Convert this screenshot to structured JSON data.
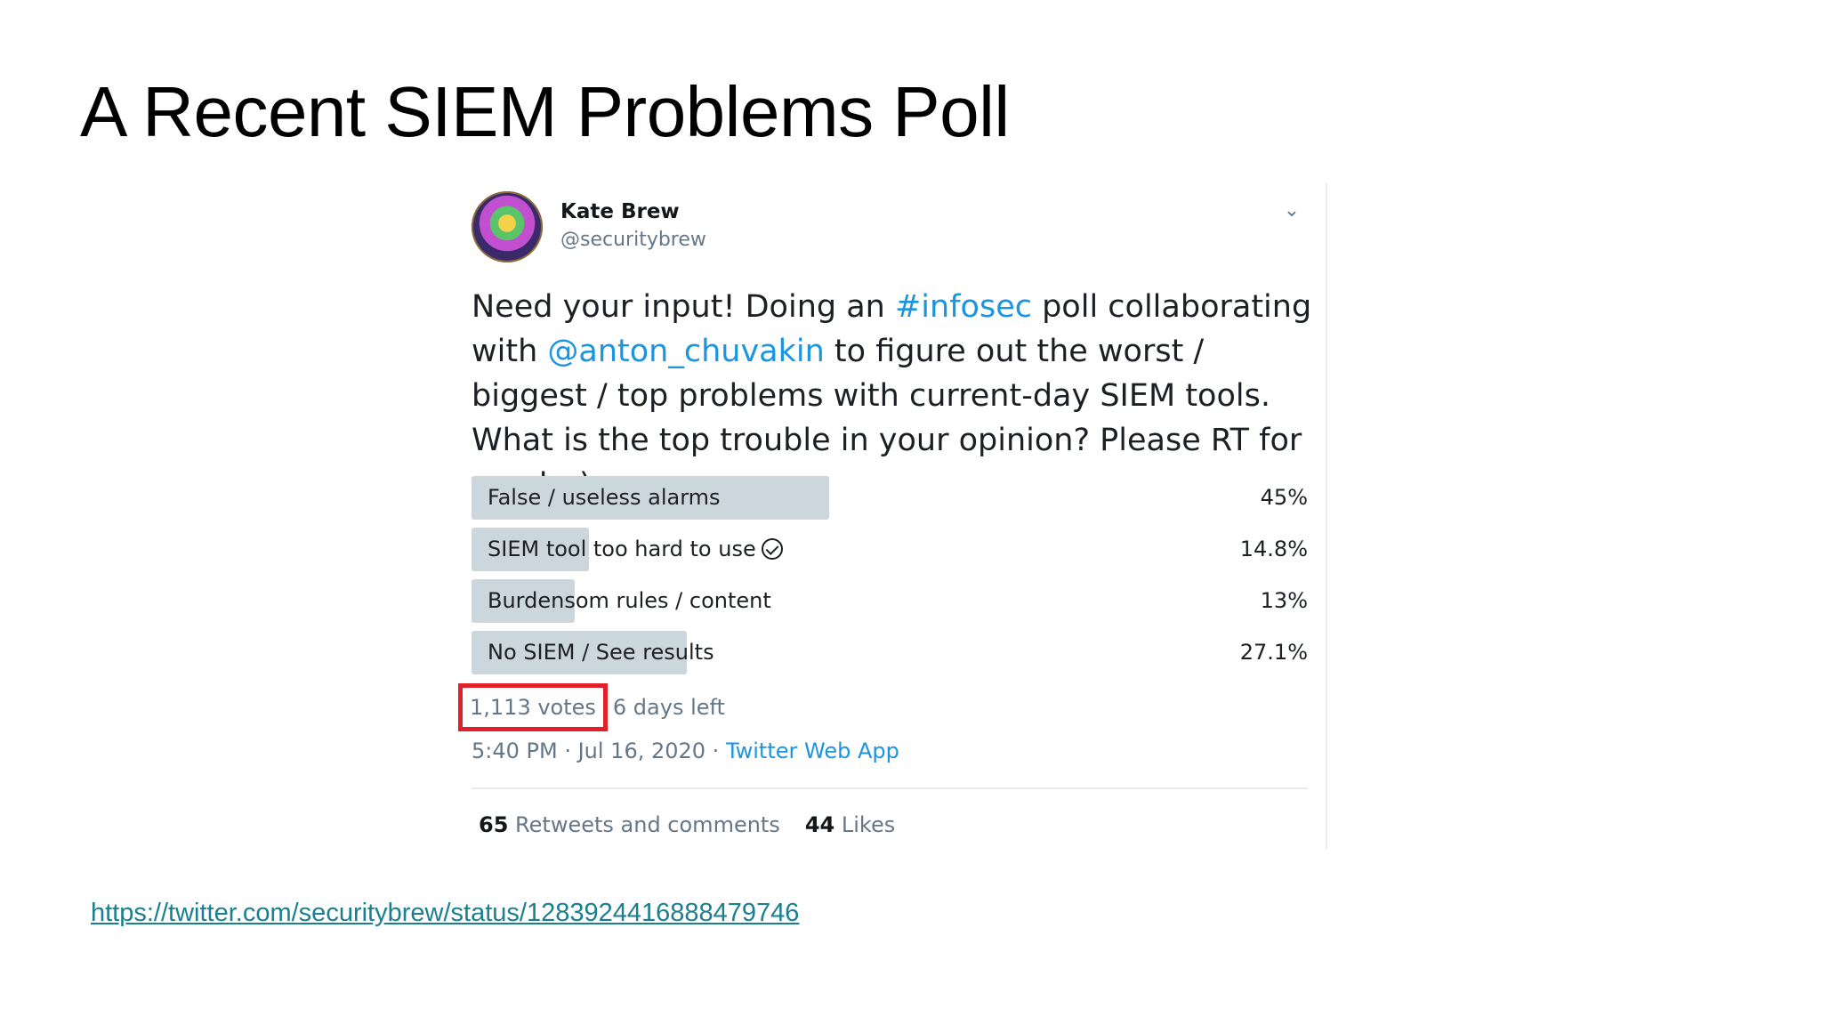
{
  "slide": {
    "title": "A Recent SIEM Problems Poll",
    "link": "https://twitter.com/securitybrew/status/1283924416888479746"
  },
  "tweet": {
    "author_name": "Kate Brew",
    "author_handle": "@securitybrew",
    "menu_icon": "chevron-down-icon",
    "text_parts": {
      "p1": "Need your input! Doing an ",
      "hashtag": "#infosec",
      "p2": " poll collaborating with ",
      "mention": "@anton_chuvakin",
      "p3": " to figure out the worst / biggest / top problems with current-day SIEM tools. What is the top trouble in your opinion? Please RT for reach :)"
    },
    "poll": {
      "options": [
        {
          "label": "False / useless alarms",
          "percent": "45%",
          "value": 45
        },
        {
          "label": "SIEM tool too hard to use",
          "percent": "14.8%",
          "value": 14.8,
          "voted": true
        },
        {
          "label": "Burdensom rules / content",
          "percent": "13%",
          "value": 13
        },
        {
          "label": "No SIEM / See results",
          "percent": "27.1%",
          "value": 27.1
        }
      ],
      "votes": "1,113 votes",
      "days_left": "6 days left"
    },
    "time": "5:40 PM · Jul 16, 2020 · ",
    "source": "Twitter Web App",
    "stats": {
      "retweets_count": "65",
      "retweets_label": "Retweets and comments",
      "likes_count": "44",
      "likes_label": "Likes"
    }
  },
  "colors": {
    "link": "#1b95e0",
    "poll_bar": "#ccd6dd",
    "highlight_box": "#e2202a",
    "footer_link": "#1a7f8e"
  }
}
